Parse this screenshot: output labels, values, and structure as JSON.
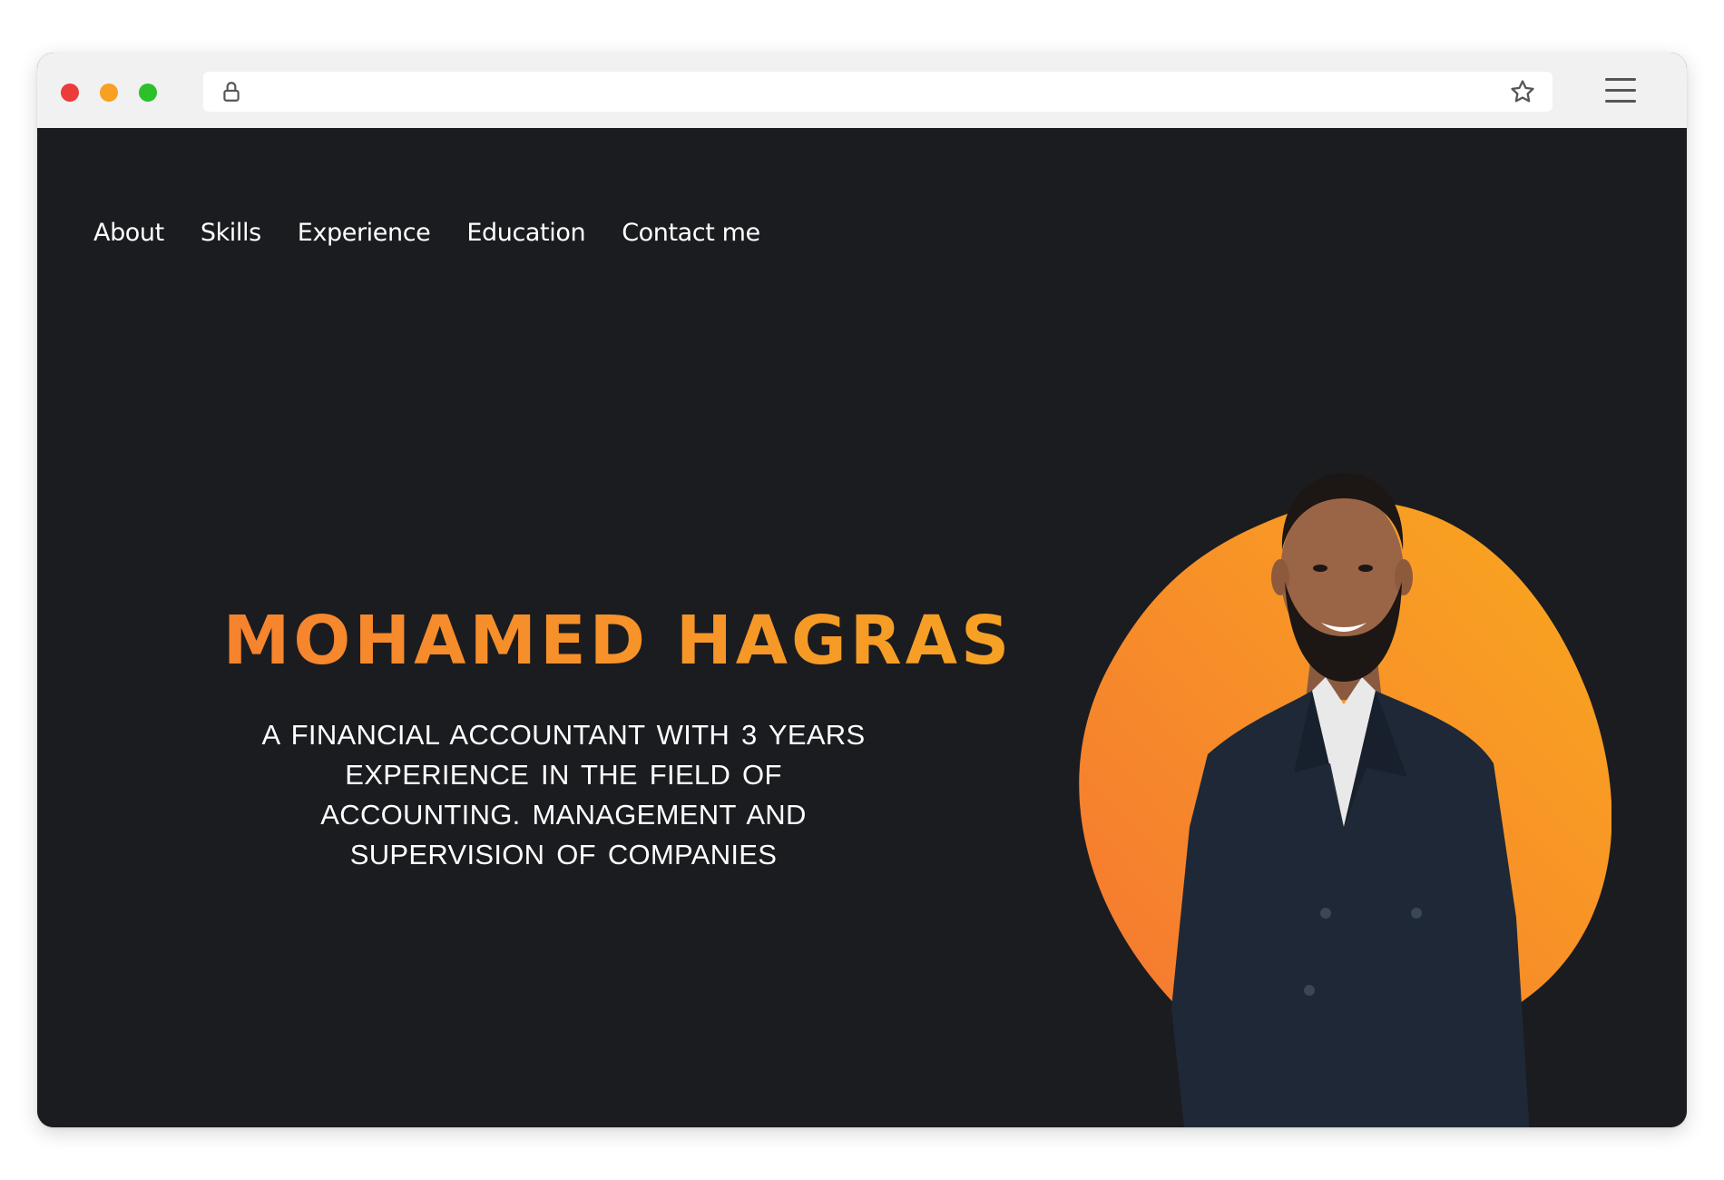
{
  "browser": {
    "window_controls": [
      "close",
      "minimize",
      "maximize"
    ],
    "address_bar": {
      "url": "",
      "lock_icon": "lock-icon",
      "bookmark_icon": "star-icon"
    },
    "menu_icon": "hamburger-menu-icon"
  },
  "nav": {
    "items": [
      {
        "label": "About"
      },
      {
        "label": "Skills"
      },
      {
        "label": "Experience"
      },
      {
        "label": "Education"
      },
      {
        "label": "Contact me"
      }
    ]
  },
  "hero": {
    "name": "MOHAMED HAGRAS",
    "description": "A FINANCIAL ACCOUNTANT WITH 3 YEARS EXPERIENCE IN THE FIELD OF ACCOUNTING. MANAGEMENT AND SUPERVISION OF COMPANIES"
  },
  "colors": {
    "page_background": "#1b1c20",
    "accent_orange": "#f6812f",
    "accent_amber": "#f6a423",
    "nav_text": "#ffffff"
  }
}
